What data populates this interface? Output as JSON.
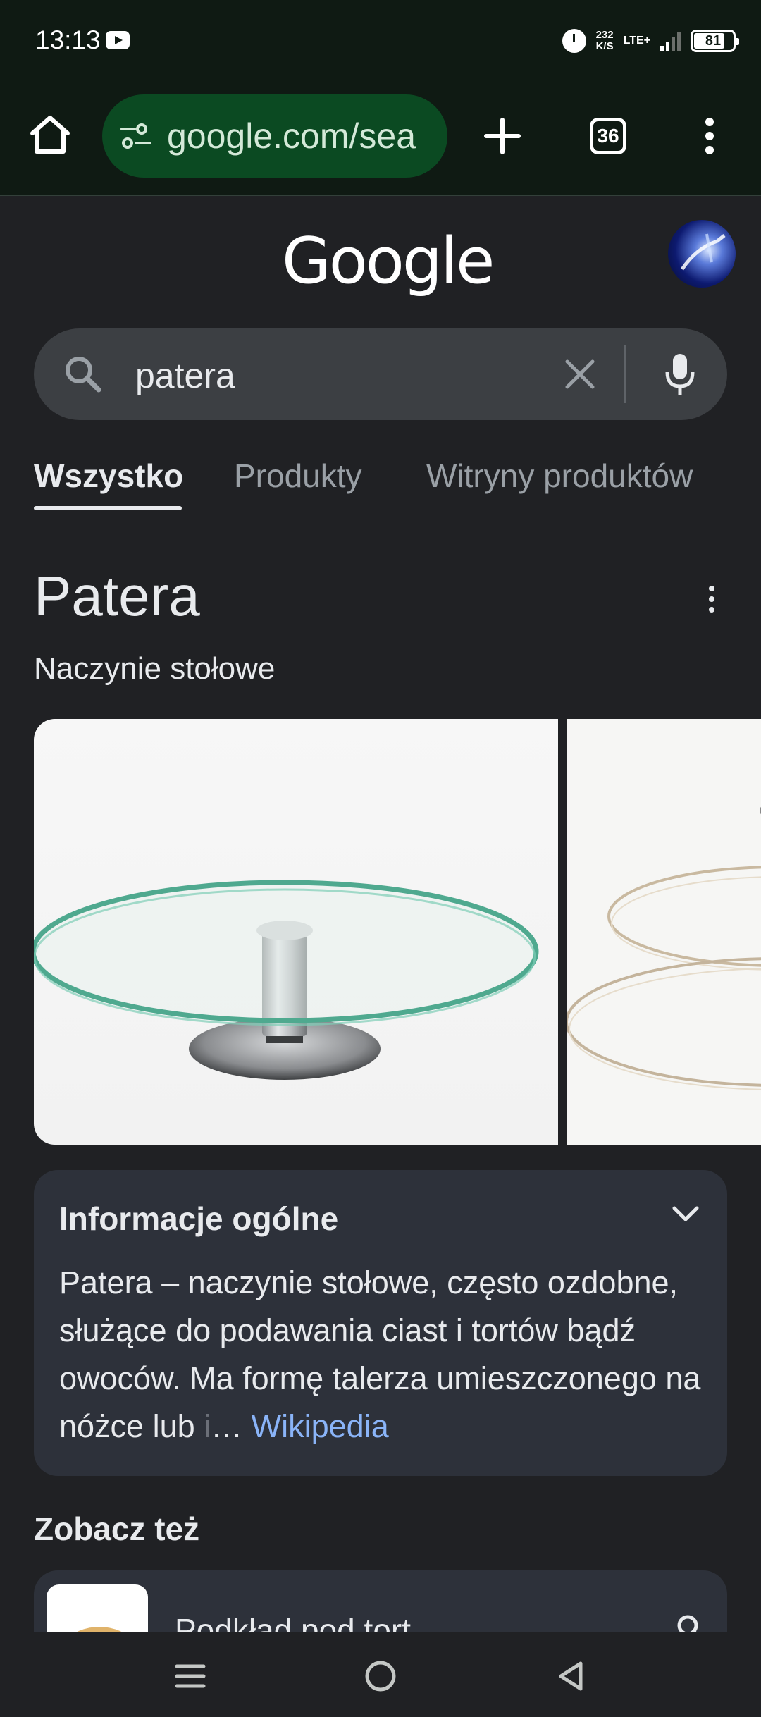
{
  "status_bar": {
    "time": "13:13",
    "net_speed_value": "232",
    "net_speed_unit": "K/S",
    "network": "LTE+",
    "battery": "81",
    "battery_level": 0.81,
    "icons": [
      "youtube-icon",
      "alarm-icon",
      "signal-icon",
      "battery-icon"
    ]
  },
  "browser": {
    "url": "google.com/sea",
    "tab_count": "36",
    "colors": {
      "toolbar_bg": "#0f1a13",
      "url_pill_bg": "#0b4a22"
    }
  },
  "google": {
    "logo": "Google"
  },
  "search": {
    "query": "patera"
  },
  "tabs": [
    {
      "label": "Wszystko",
      "active": true
    },
    {
      "label": "Produkty",
      "active": false
    },
    {
      "label": "Witryny produktów",
      "active": false
    }
  ],
  "knowledge_panel": {
    "title": "Patera",
    "subtitle": "Naczynie stołowe",
    "info": {
      "title": "Informacje ogólne",
      "text": "Patera – naczynie stołowe, często ozdobne, służące do podawania ciast i tortów bądź owoców. Ma formę talerza umieszczonego na nóżce lub ",
      "faded": "i",
      "ellipsis": "… ",
      "source": "Wikipedia"
    }
  },
  "see_also": {
    "title": "Zobacz też",
    "items": [
      {
        "label": "Podkład pod tort"
      }
    ]
  },
  "colors": {
    "page_bg": "#202124",
    "card_bg": "#2d313a",
    "link": "#8ab4f8"
  }
}
